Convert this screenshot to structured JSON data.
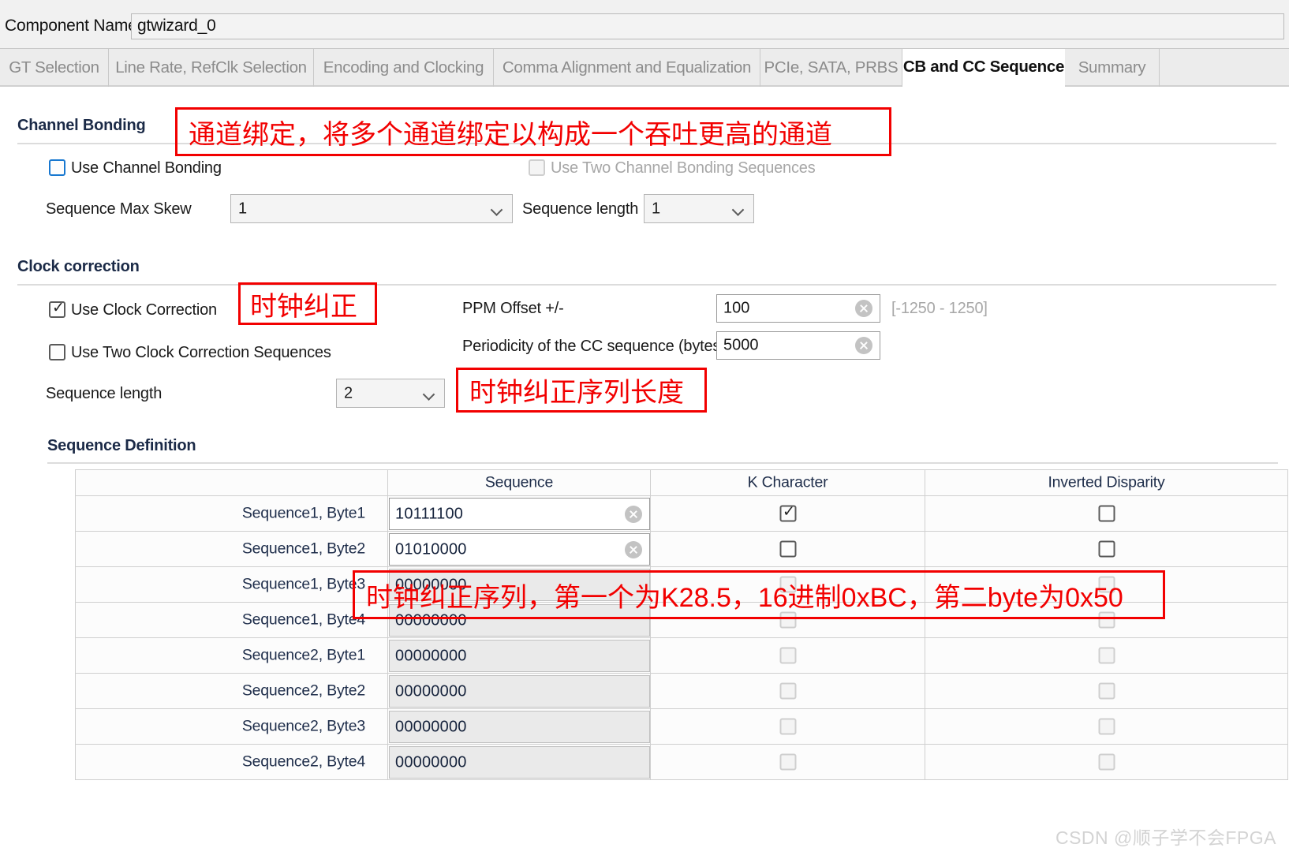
{
  "header": {
    "component_name_label": "Component Name",
    "component_name_value": "gtwizard_0"
  },
  "tabs": [
    {
      "label": "GT Selection",
      "active": false
    },
    {
      "label": "Line Rate, RefClk Selection",
      "active": false
    },
    {
      "label": "Encoding and Clocking",
      "active": false
    },
    {
      "label": "Comma Alignment and Equalization",
      "active": false
    },
    {
      "label": "PCIe, SATA, PRBS",
      "active": false
    },
    {
      "label": "CB and CC Sequence",
      "active": true
    },
    {
      "label": "Summary",
      "active": false
    }
  ],
  "channel_bonding": {
    "title": "Channel Bonding",
    "use_channel_bonding_label": "Use Channel Bonding",
    "use_channel_bonding_checked": false,
    "use_two_cb_sequences_label": "Use Two Channel Bonding Sequences",
    "use_two_cb_sequences_checked": false,
    "sequence_max_skew_label": "Sequence Max Skew",
    "sequence_max_skew_value": "1",
    "sequence_length_label": "Sequence length",
    "sequence_length_value": "1"
  },
  "clock_correction": {
    "title": "Clock correction",
    "use_clock_correction_label": "Use Clock Correction",
    "use_clock_correction_checked": true,
    "use_two_cc_sequences_label": "Use Two Clock Correction Sequences",
    "use_two_cc_sequences_checked": false,
    "sequence_length_label": "Sequence length",
    "sequence_length_value": "2",
    "ppm_offset_label": "PPM Offset +/-",
    "ppm_offset_value": "100",
    "ppm_offset_range": "[-1250 - 1250]",
    "periodicity_label": "Periodicity of the CC sequence (bytes)",
    "periodicity_value": "5000"
  },
  "sequence_definition": {
    "title": "Sequence Definition",
    "columns": [
      "",
      "Sequence",
      "K Character",
      "Inverted Disparity"
    ],
    "rows": [
      {
        "name": "Sequence1, Byte1",
        "sequence": "10111100",
        "enabled": true,
        "k_character": true,
        "inverted_disparity": false
      },
      {
        "name": "Sequence1, Byte2",
        "sequence": "01010000",
        "enabled": true,
        "k_character": false,
        "inverted_disparity": false
      },
      {
        "name": "Sequence1, Byte3",
        "sequence": "00000000",
        "enabled": false,
        "k_character": false,
        "inverted_disparity": false
      },
      {
        "name": "Sequence1, Byte4",
        "sequence": "00000000",
        "enabled": false,
        "k_character": false,
        "inverted_disparity": false
      },
      {
        "name": "Sequence2, Byte1",
        "sequence": "00000000",
        "enabled": false,
        "k_character": false,
        "inverted_disparity": false
      },
      {
        "name": "Sequence2, Byte2",
        "sequence": "00000000",
        "enabled": false,
        "k_character": false,
        "inverted_disparity": false
      },
      {
        "name": "Sequence2, Byte3",
        "sequence": "00000000",
        "enabled": false,
        "k_character": false,
        "inverted_disparity": false
      },
      {
        "name": "Sequence2, Byte4",
        "sequence": "00000000",
        "enabled": false,
        "k_character": false,
        "inverted_disparity": false
      }
    ]
  },
  "annotations": {
    "channel_bonding_note": "通道绑定，将多个通道绑定以构成一个吞吐更高的通道",
    "clock_correction_note": "时钟纠正",
    "sequence_length_note": "时钟纠正序列长度",
    "sequence_table_note": "时钟纠正序列，第一个为K28.5，16进制0xBC，第二byte为0x50",
    "color": "#f20000"
  },
  "watermark": "CSDN @顺子学不会FPGA"
}
